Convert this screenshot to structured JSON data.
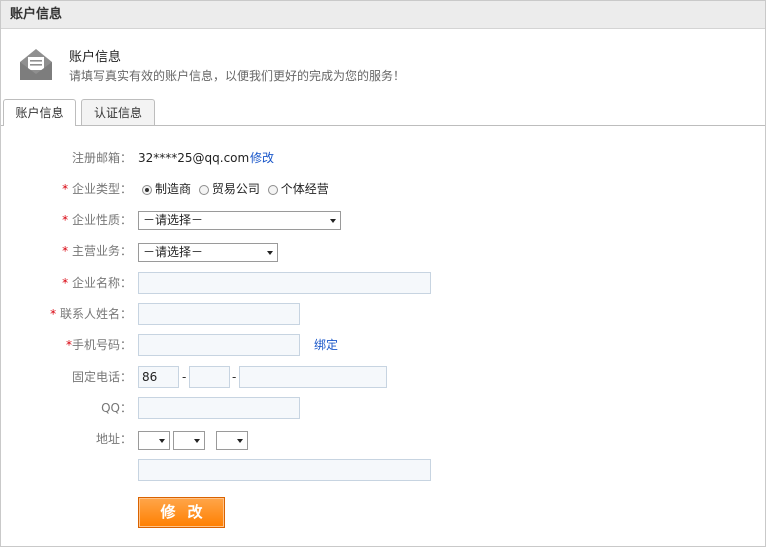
{
  "panel": {
    "title": "账户信息"
  },
  "banner": {
    "icon": "envelope-icon",
    "title": "账户信息",
    "description": "请填写真实有效的账户信息，以便我们更好的完成为您的服务！"
  },
  "tabs": [
    {
      "label": "账户信息",
      "active": true
    },
    {
      "label": "认证信息",
      "active": false
    }
  ],
  "form": {
    "email": {
      "label": "注册邮箱：",
      "value": "32****25@qq.com",
      "action": "修改"
    },
    "company_type": {
      "required_mark": "*",
      "label": "企业类型：",
      "options": [
        {
          "label": "制造商",
          "checked": true
        },
        {
          "label": "贸易公司",
          "checked": false
        },
        {
          "label": "个体经营",
          "checked": false
        }
      ]
    },
    "company_nature": {
      "required_mark": "*",
      "label": "企业性质：",
      "selected": "－请选择－"
    },
    "main_business": {
      "required_mark": "*",
      "label": "主营业务：",
      "selected": "－请选择－"
    },
    "company_name": {
      "required_mark": "*",
      "label": "企业名称：",
      "value": ""
    },
    "contact_name": {
      "required_mark": "*",
      "label": "联系人姓名：",
      "value": ""
    },
    "mobile": {
      "required_mark": "*",
      "label": "手机号码：",
      "value": "",
      "action": "绑定"
    },
    "phone": {
      "label": "固定电话：",
      "country_code": "86",
      "area_code": "",
      "number": "",
      "separator": "-"
    },
    "qq": {
      "label": "QQ：",
      "value": ""
    },
    "address": {
      "label": "地址：",
      "province": "",
      "city": "",
      "district": "",
      "detail": ""
    },
    "submit": {
      "label": "修改"
    }
  }
}
